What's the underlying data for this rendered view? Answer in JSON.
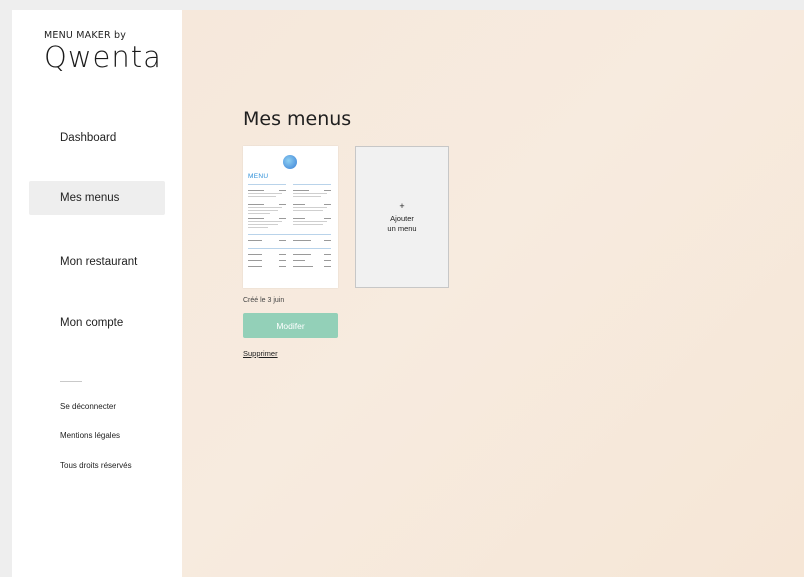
{
  "brand": {
    "top": "MENU MAKER by",
    "logo": "Qwenta"
  },
  "sidebar": {
    "items": [
      {
        "label": "Dashboard"
      },
      {
        "label": "Mes menus"
      },
      {
        "label": "Mon restaurant"
      },
      {
        "label": "Mon compte"
      }
    ],
    "footer": [
      {
        "label": "Se déconnecter"
      },
      {
        "label": "Mentions légales"
      },
      {
        "label": "Tous droits réservés"
      }
    ]
  },
  "main": {
    "title": "Mes menus",
    "menu_card": {
      "title": "MENU"
    },
    "add_card": {
      "plus": "+",
      "label": "Ajouter\nun menu"
    },
    "created": "Créé le 3 juin",
    "modify_label": "Modifer",
    "delete_label": "Supprimer"
  },
  "colors": {
    "accent_button": "#93d0b8",
    "menu_accent": "#2d8fd8",
    "background": "#f6e8db"
  }
}
